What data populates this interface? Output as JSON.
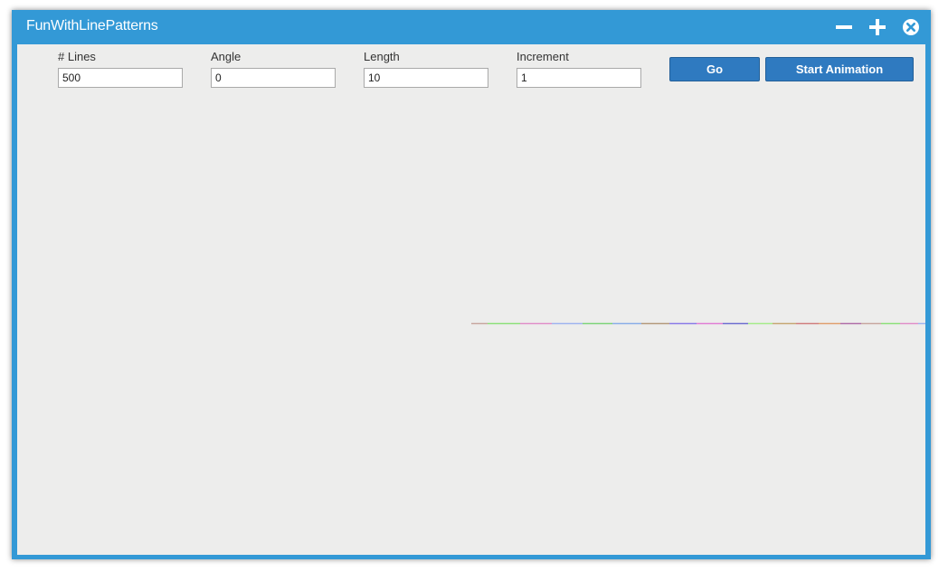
{
  "window": {
    "title": "FunWithLinePatterns",
    "controls": [
      "minimize-icon",
      "maximize-icon",
      "close-icon"
    ]
  },
  "form": {
    "lines": {
      "label": "# Lines",
      "value": "500"
    },
    "angle": {
      "label": "Angle",
      "value": "0"
    },
    "length": {
      "label": "Length",
      "value": "10"
    },
    "increment": {
      "label": "Increment",
      "value": "1"
    }
  },
  "buttons": {
    "go": "Go",
    "start_animation": "Start Animation"
  },
  "colors": {
    "accent": "#3399d6",
    "button": "#2f7ac0",
    "canvas": "#ededec",
    "line_palette": [
      "#c7a7a0",
      "#8ee07a",
      "#e08fc9",
      "#9fb4ef",
      "#7fd47a",
      "#8aaee8",
      "#b49b7c",
      "#8c7be8",
      "#e07fd6",
      "#6f6fd0",
      "#a6ec8a",
      "#c6a774",
      "#d07f7f",
      "#e0a070",
      "#b06fa8"
    ]
  }
}
